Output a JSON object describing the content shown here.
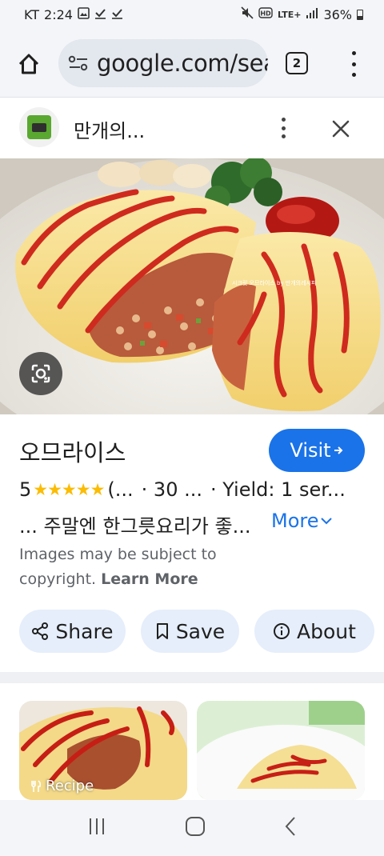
{
  "status_bar": {
    "carrier": "KT",
    "time": "2:24",
    "network": "LTE+",
    "battery": "36%"
  },
  "browser": {
    "url": "google.com/search",
    "tab_count": "2"
  },
  "panel": {
    "site_name": "만개의...",
    "image_watermark": "시크릿 오므라이스 by 만개의레시피"
  },
  "result": {
    "title": "오므라이스",
    "visit_label": "Visit",
    "rating": "5",
    "stars": "★★★★★",
    "reviews": "(...",
    "time": "· 30 ...",
    "yield": "· Yield: 1 ser...",
    "description": "... 주말엔 한그릇요리가 좋...",
    "more_label": "More",
    "copyright_text": "Images may be subject to copyright.",
    "learn_more": "Learn More"
  },
  "actions": {
    "share": "Share",
    "save": "Save",
    "about": "About"
  },
  "related": {
    "tag": "Recipe"
  },
  "colors": {
    "accent": "#1a73e8",
    "chip_bg": "#e6eefb",
    "star": "#fbbc04"
  }
}
